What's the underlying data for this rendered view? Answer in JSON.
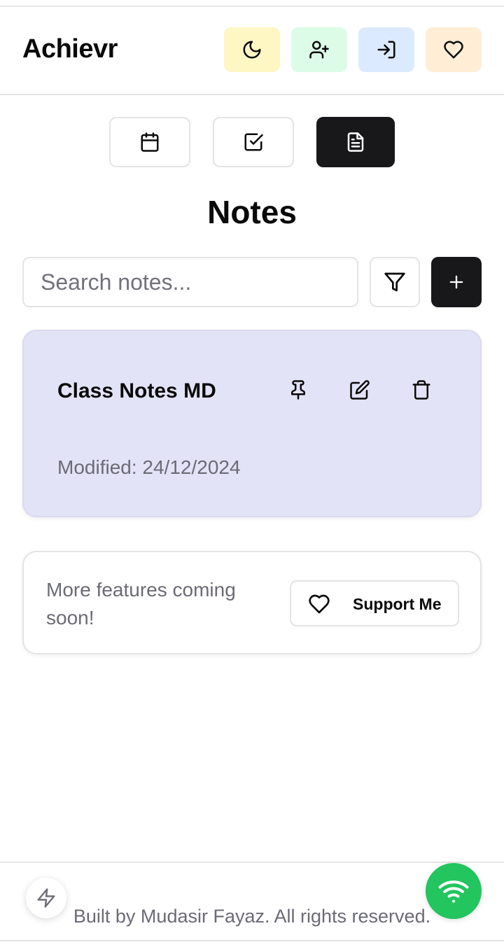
{
  "app": {
    "title": "Achievr"
  },
  "header": {
    "buttons": [
      {
        "icon": "moon-icon",
        "color": "#fef7c3"
      },
      {
        "icon": "user-plus-icon",
        "color": "#dcfce7"
      },
      {
        "icon": "log-in-icon",
        "color": "#dbeafe"
      },
      {
        "icon": "heart-icon",
        "color": "#ffedd5"
      }
    ]
  },
  "tabs": [
    {
      "icon": "calendar-icon",
      "active": false
    },
    {
      "icon": "checkbox-icon",
      "active": false
    },
    {
      "icon": "file-text-icon",
      "active": true
    }
  ],
  "page": {
    "title": "Notes"
  },
  "search": {
    "placeholder": "Search notes...",
    "value": ""
  },
  "notes": [
    {
      "title": "Class Notes MD",
      "modified": "Modified: 24/12/2024",
      "color": "#e3e3f8"
    }
  ],
  "promo": {
    "text": "More features coming soon!",
    "button_label": "Support Me"
  },
  "footer": {
    "text": "Built by Mudasir Fayaz. All rights reserved."
  },
  "colors": {
    "accent": "#18181b",
    "online": "#22c55e"
  }
}
